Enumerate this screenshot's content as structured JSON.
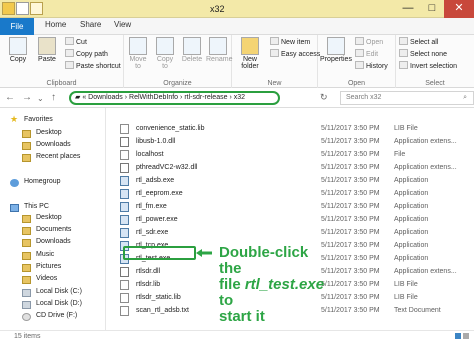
{
  "window": {
    "title": "x32",
    "controls": [
      "—",
      "□",
      "✕"
    ]
  },
  "ribbon": {
    "tabs": [
      "File",
      "Home",
      "Share",
      "View"
    ],
    "clipboard": {
      "label": "Clipboard",
      "copy": "Copy",
      "paste": "Paste",
      "cut": "Cut",
      "copy_path": "Copy path",
      "paste_shortcut": "Paste shortcut"
    },
    "organize": {
      "label": "Organize",
      "move_to": "Move to",
      "copy_to": "Copy to",
      "delete": "Delete",
      "rename": "Rename"
    },
    "new": {
      "label": "New",
      "new_folder": "New folder",
      "new_item": "New item",
      "easy_access": "Easy access"
    },
    "open": {
      "label": "Open",
      "properties": "Properties",
      "open": "Open",
      "edit": "Edit",
      "history": "History"
    },
    "select": {
      "label": "Select",
      "select_all": "Select all",
      "select_none": "Select none",
      "invert_selection": "Invert selection"
    }
  },
  "address": {
    "breadcrumb": [
      "Downloads",
      "RelWithDebInfo",
      "rtl-sdr-release",
      "x32"
    ],
    "search_placeholder": "Search x32"
  },
  "navigation": {
    "favorites": {
      "label": "Favorites",
      "items": [
        "Desktop",
        "Downloads",
        "Recent places"
      ]
    },
    "homegroup": "Homegroup",
    "this_pc": {
      "label": "This PC",
      "items": [
        "Desktop",
        "Documents",
        "Downloads",
        "Music",
        "Pictures",
        "Videos",
        "Local Disk (C:)",
        "Local Disk (D:)",
        "CD Drive (F:)"
      ]
    }
  },
  "files": [
    {
      "name": "convenience_static.lib",
      "date": "5/11/2017 3:50 PM",
      "type": "LIB File",
      "icon": "document-icon"
    },
    {
      "name": "libusb-1.0.dll",
      "date": "5/11/2017 3:50 PM",
      "type": "Application extens...",
      "icon": "dll-icon"
    },
    {
      "name": "localhost",
      "date": "5/11/2017 3:50 PM",
      "type": "File",
      "icon": "document-icon"
    },
    {
      "name": "pthreadVC2-w32.dll",
      "date": "5/11/2017 3:50 PM",
      "type": "Application extens...",
      "icon": "dll-icon"
    },
    {
      "name": "rtl_adsb.exe",
      "date": "5/11/2017 3:50 PM",
      "type": "Application",
      "icon": "exe-icon"
    },
    {
      "name": "rtl_eeprom.exe",
      "date": "5/11/2017 3:50 PM",
      "type": "Application",
      "icon": "exe-icon"
    },
    {
      "name": "rtl_fm.exe",
      "date": "5/11/2017 3:50 PM",
      "type": "Application",
      "icon": "exe-icon"
    },
    {
      "name": "rtl_power.exe",
      "date": "5/11/2017 3:50 PM",
      "type": "Application",
      "icon": "exe-icon"
    },
    {
      "name": "rtl_sdr.exe",
      "date": "5/11/2017 3:50 PM",
      "type": "Application",
      "icon": "exe-icon"
    },
    {
      "name": "rtl_tcp.exe",
      "date": "5/11/2017 3:50 PM",
      "type": "Application",
      "icon": "exe-icon"
    },
    {
      "name": "rtl_test.exe",
      "date": "5/11/2017 3:50 PM",
      "type": "Application",
      "icon": "exe-icon"
    },
    {
      "name": "rtlsdr.dll",
      "date": "5/11/2017 3:50 PM",
      "type": "Application extens...",
      "icon": "dll-icon"
    },
    {
      "name": "rtlsdr.lib",
      "date": "5/11/2017 3:50 PM",
      "type": "LIB File",
      "icon": "document-icon"
    },
    {
      "name": "rtlsdr_static.lib",
      "date": "5/11/2017 3:50 PM",
      "type": "LIB File",
      "icon": "document-icon"
    },
    {
      "name": "scan_rtl_adsb.txt",
      "date": "5/11/2017 3:50 PM",
      "type": "Text Document",
      "icon": "document-icon"
    }
  ],
  "callout": {
    "line1": "Double-click the",
    "line2_prefix": "file ",
    "line2_name": "rtl_test.exe",
    "line2_suffix": " to",
    "line3": "start it",
    "color": "#2da545"
  },
  "status": {
    "item_count": "15 items"
  }
}
